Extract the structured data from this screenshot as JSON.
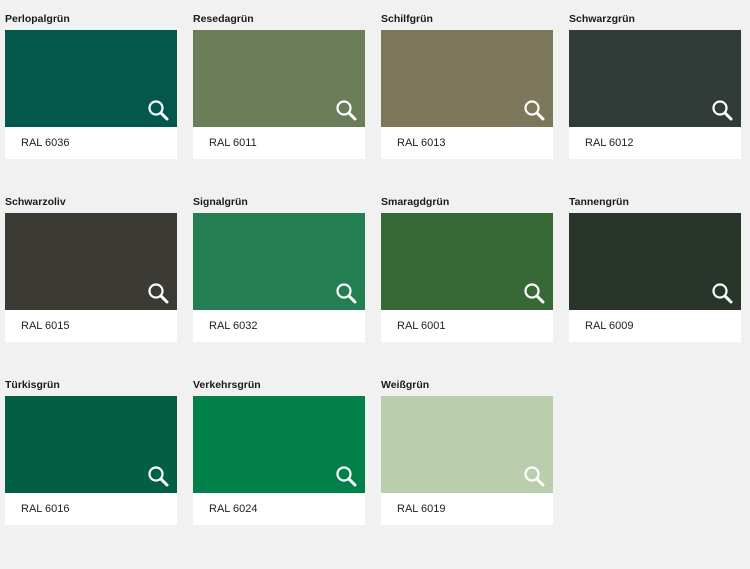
{
  "swatches": [
    {
      "name": "Perlopalgrün",
      "code": "RAL 6036",
      "color": "#04574b"
    },
    {
      "name": "Resedagrün",
      "code": "RAL 6011",
      "color": "#6b7c59"
    },
    {
      "name": "Schilfgrün",
      "code": "RAL 6013",
      "color": "#7c765a"
    },
    {
      "name": "Schwarzgrün",
      "code": "RAL 6012",
      "color": "#313c39"
    },
    {
      "name": "Schwarzoliv",
      "code": "RAL 6015",
      "color": "#3c3a35"
    },
    {
      "name": "Signalgrün",
      "code": "RAL 6032",
      "color": "#237f52"
    },
    {
      "name": "Smaragdgrün",
      "code": "RAL 6001",
      "color": "#366935"
    },
    {
      "name": "Tannengrün",
      "code": "RAL 6009",
      "color": "#27352b"
    },
    {
      "name": "Türkisgrün",
      "code": "RAL 6016",
      "color": "#025f44"
    },
    {
      "name": "Verkehrsgrün",
      "code": "RAL 6024",
      "color": "#018149"
    },
    {
      "name": "Weißgrün",
      "code": "RAL 6019",
      "color": "#bacead"
    }
  ],
  "icons": {
    "zoom": "magnifier-icon"
  }
}
